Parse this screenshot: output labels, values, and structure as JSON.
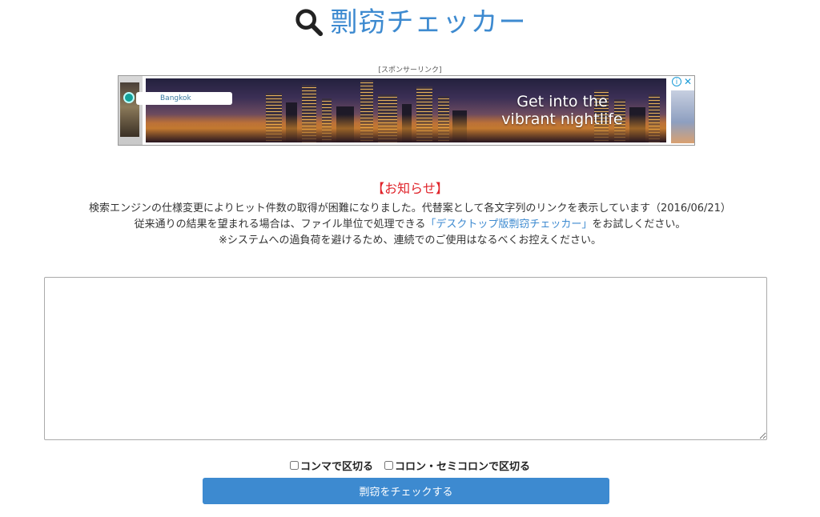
{
  "header": {
    "title": "剽窃チェッカー",
    "icon": "search-icon",
    "title_color": "#3d8ad0"
  },
  "ad": {
    "sponsor_label": "[スポンサーリンク]",
    "location_label": "Bangkok",
    "headline_line1": "Get into the",
    "headline_line2": "vibrant nightlife"
  },
  "notice": {
    "title": "【お知らせ】",
    "line1": "検索エンジンの仕様変更によりヒット件数の取得が困難になりました。代替案として各文字列のリンクを表示しています（2016/06/21）",
    "line2_before": "従来通りの結果を望まれる場合は、ファイル単位で処理できる",
    "line2_link": "「デスクトップ版剽窃チェッカー」",
    "line2_after": "をお試しください。",
    "line3": "※システムへの過負荷を避けるため、連続でのご使用はなるべくお控えください。",
    "title_color": "#e0242b",
    "link_color": "#3d8ad0"
  },
  "input": {
    "value": "",
    "placeholder": ""
  },
  "options": {
    "comma_label": "コンマで区切る",
    "comma_checked": false,
    "colon_label": "コロン・セミコロンで区切る",
    "colon_checked": false
  },
  "submit": {
    "label": "剽窃をチェックする",
    "color": "#3d8ad0"
  }
}
